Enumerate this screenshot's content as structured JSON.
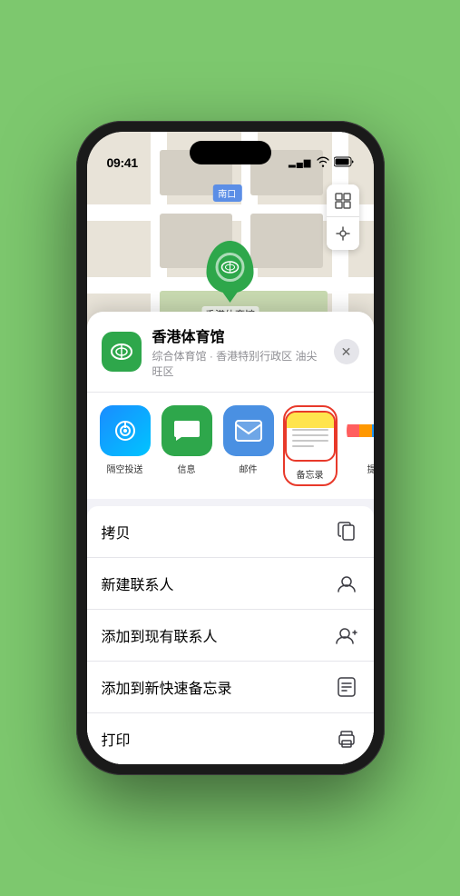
{
  "status_bar": {
    "time": "09:41",
    "signal": "▂▄▆█",
    "wifi": "WiFi",
    "battery": "Battery"
  },
  "map": {
    "label": "南口",
    "location_pin_label": "香港体育馆"
  },
  "location_card": {
    "name": "香港体育馆",
    "address": "综合体育馆 · 香港特别行政区 油尖旺区",
    "close_label": "✕"
  },
  "share_apps": [
    {
      "id": "airdrop",
      "label": "隔空投送",
      "icon": "📶"
    },
    {
      "id": "messages",
      "label": "信息",
      "icon": "💬"
    },
    {
      "id": "mail",
      "label": "邮件",
      "icon": "✉️"
    },
    {
      "id": "notes",
      "label": "备忘录",
      "icon": "📝",
      "selected": true
    },
    {
      "id": "more",
      "label": "提",
      "icon": "⋯"
    }
  ],
  "action_items": [
    {
      "id": "copy",
      "label": "拷贝",
      "icon": "copy"
    },
    {
      "id": "new-contact",
      "label": "新建联系人",
      "icon": "person"
    },
    {
      "id": "add-contact",
      "label": "添加到现有联系人",
      "icon": "person-add"
    },
    {
      "id": "add-note",
      "label": "添加到新快速备忘录",
      "icon": "note"
    },
    {
      "id": "print",
      "label": "打印",
      "icon": "print"
    }
  ]
}
